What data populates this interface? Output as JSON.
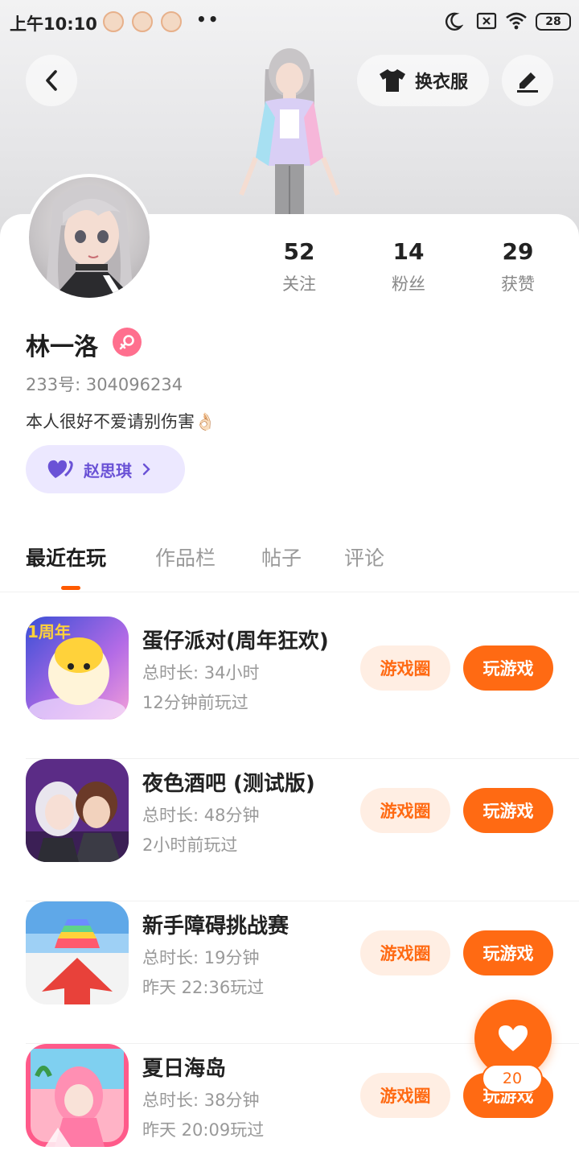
{
  "status_bar": {
    "time": "上午10:10",
    "dots": "••",
    "battery": "28"
  },
  "header": {
    "back_icon": "chevron-left-icon",
    "outfit_label": "换衣服",
    "edit_icon": "pencil-icon"
  },
  "profile": {
    "stats": [
      {
        "value": "52",
        "label": "关注"
      },
      {
        "value": "14",
        "label": "粉丝"
      },
      {
        "value": "29",
        "label": "获赞"
      }
    ],
    "name": "林一洛",
    "gender_icon": "female-icon",
    "uid": "233号: 304096234",
    "bio": "本人很好不爱请别伤害👌🏻",
    "cp_name": "赵思琪"
  },
  "tabs": [
    {
      "label": "最近在玩",
      "active": true
    },
    {
      "label": "作品栏",
      "active": false
    },
    {
      "label": "帖子",
      "active": false
    },
    {
      "label": "评论",
      "active": false
    }
  ],
  "games": [
    {
      "title": "蛋仔派对(周年狂欢)",
      "duration": "总时长: 34小时",
      "last_played": "12分钟前玩过",
      "circle_label": "游戏圈",
      "play_label": "玩游戏",
      "icon_label": "1周年"
    },
    {
      "title": "夜色酒吧 (测试版)",
      "duration": "总时长: 48分钟",
      "last_played": "2小时前玩过",
      "circle_label": "游戏圈",
      "play_label": "玩游戏"
    },
    {
      "title": "新手障碍挑战赛",
      "duration": "总时长: 19分钟",
      "last_played": "昨天 22:36玩过",
      "circle_label": "游戏圈",
      "play_label": "玩游戏"
    },
    {
      "title": "夏日海岛",
      "duration": "总时长: 38分钟",
      "last_played": "昨天 20:09玩过",
      "circle_label": "游戏圈",
      "play_label": "玩游戏"
    }
  ],
  "fab": {
    "icon": "heart-icon",
    "count": "20"
  },
  "colors": {
    "accent": "#ff6a13",
    "accent_light": "#ffeee3",
    "cp_purple": "#6a52d6",
    "gender_pink": "#ff6f8e"
  }
}
